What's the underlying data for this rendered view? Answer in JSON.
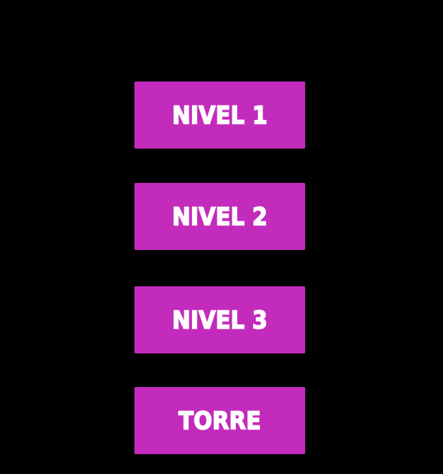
{
  "menu": {
    "buttons": [
      {
        "label": "NIVEL 1"
      },
      {
        "label": "NIVEL 2"
      },
      {
        "label": "NIVEL 3"
      },
      {
        "label": "TORRE"
      }
    ]
  },
  "colors": {
    "background": "#000000",
    "button": "#c22bbb",
    "text": "#ffffff"
  }
}
